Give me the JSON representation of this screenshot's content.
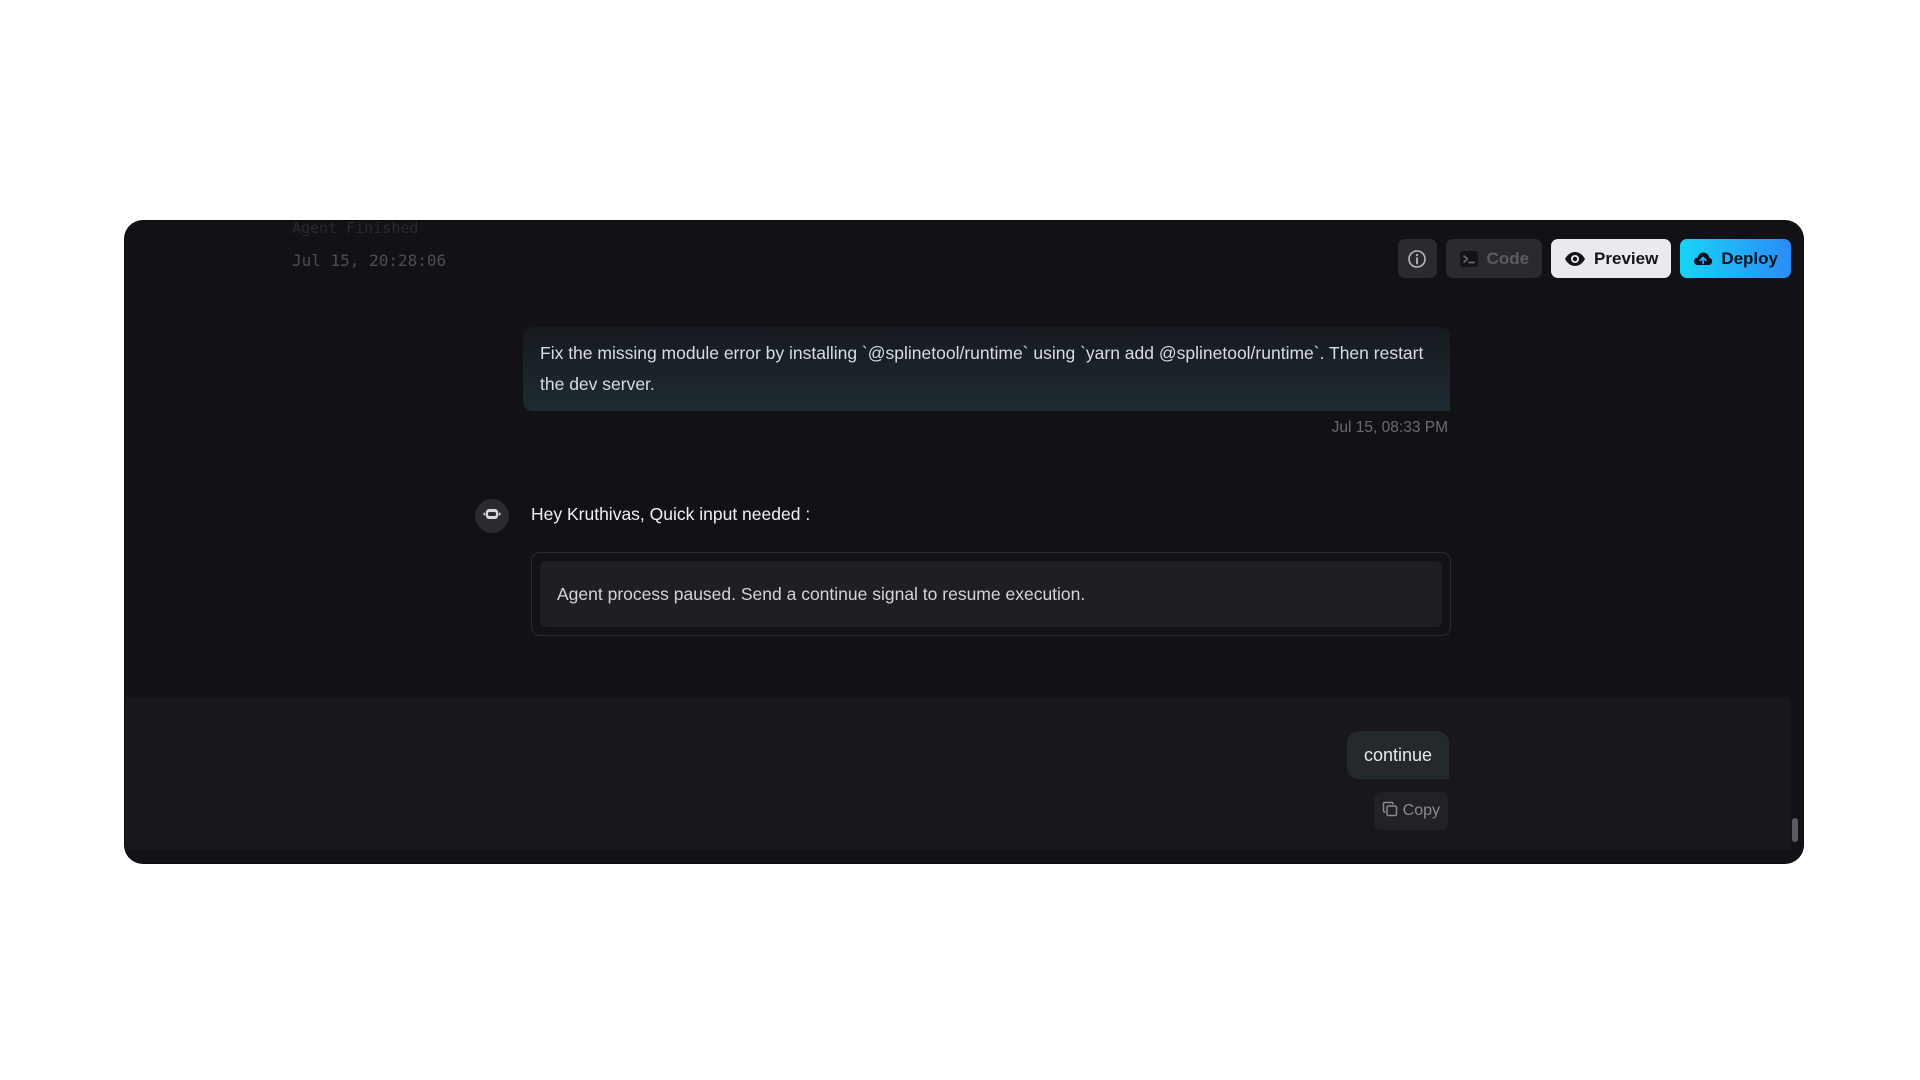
{
  "log": {
    "ghost_text": "Agent Finished",
    "timestamp": "Jul 15, 20:28:06"
  },
  "toolbar": {
    "info_icon": "info-icon",
    "code_label": "Code",
    "preview_label": "Preview",
    "deploy_label": "Deploy",
    "deploy_gradient": [
      "#18d4f5",
      "#2b8cf7"
    ]
  },
  "conversation": {
    "user_message": "Fix the missing module error by installing `@splinetool/runtime` using `yarn add @splinetool/runtime`. Then restart the dev server.",
    "user_timestamp": "Jul 15, 08:33 PM",
    "agent_title": "Hey Kruthivas, Quick input needed :",
    "agent_message": "Agent process paused. Send a continue signal to resume execution.",
    "reply_message": "continue",
    "copy_label": "Copy"
  }
}
